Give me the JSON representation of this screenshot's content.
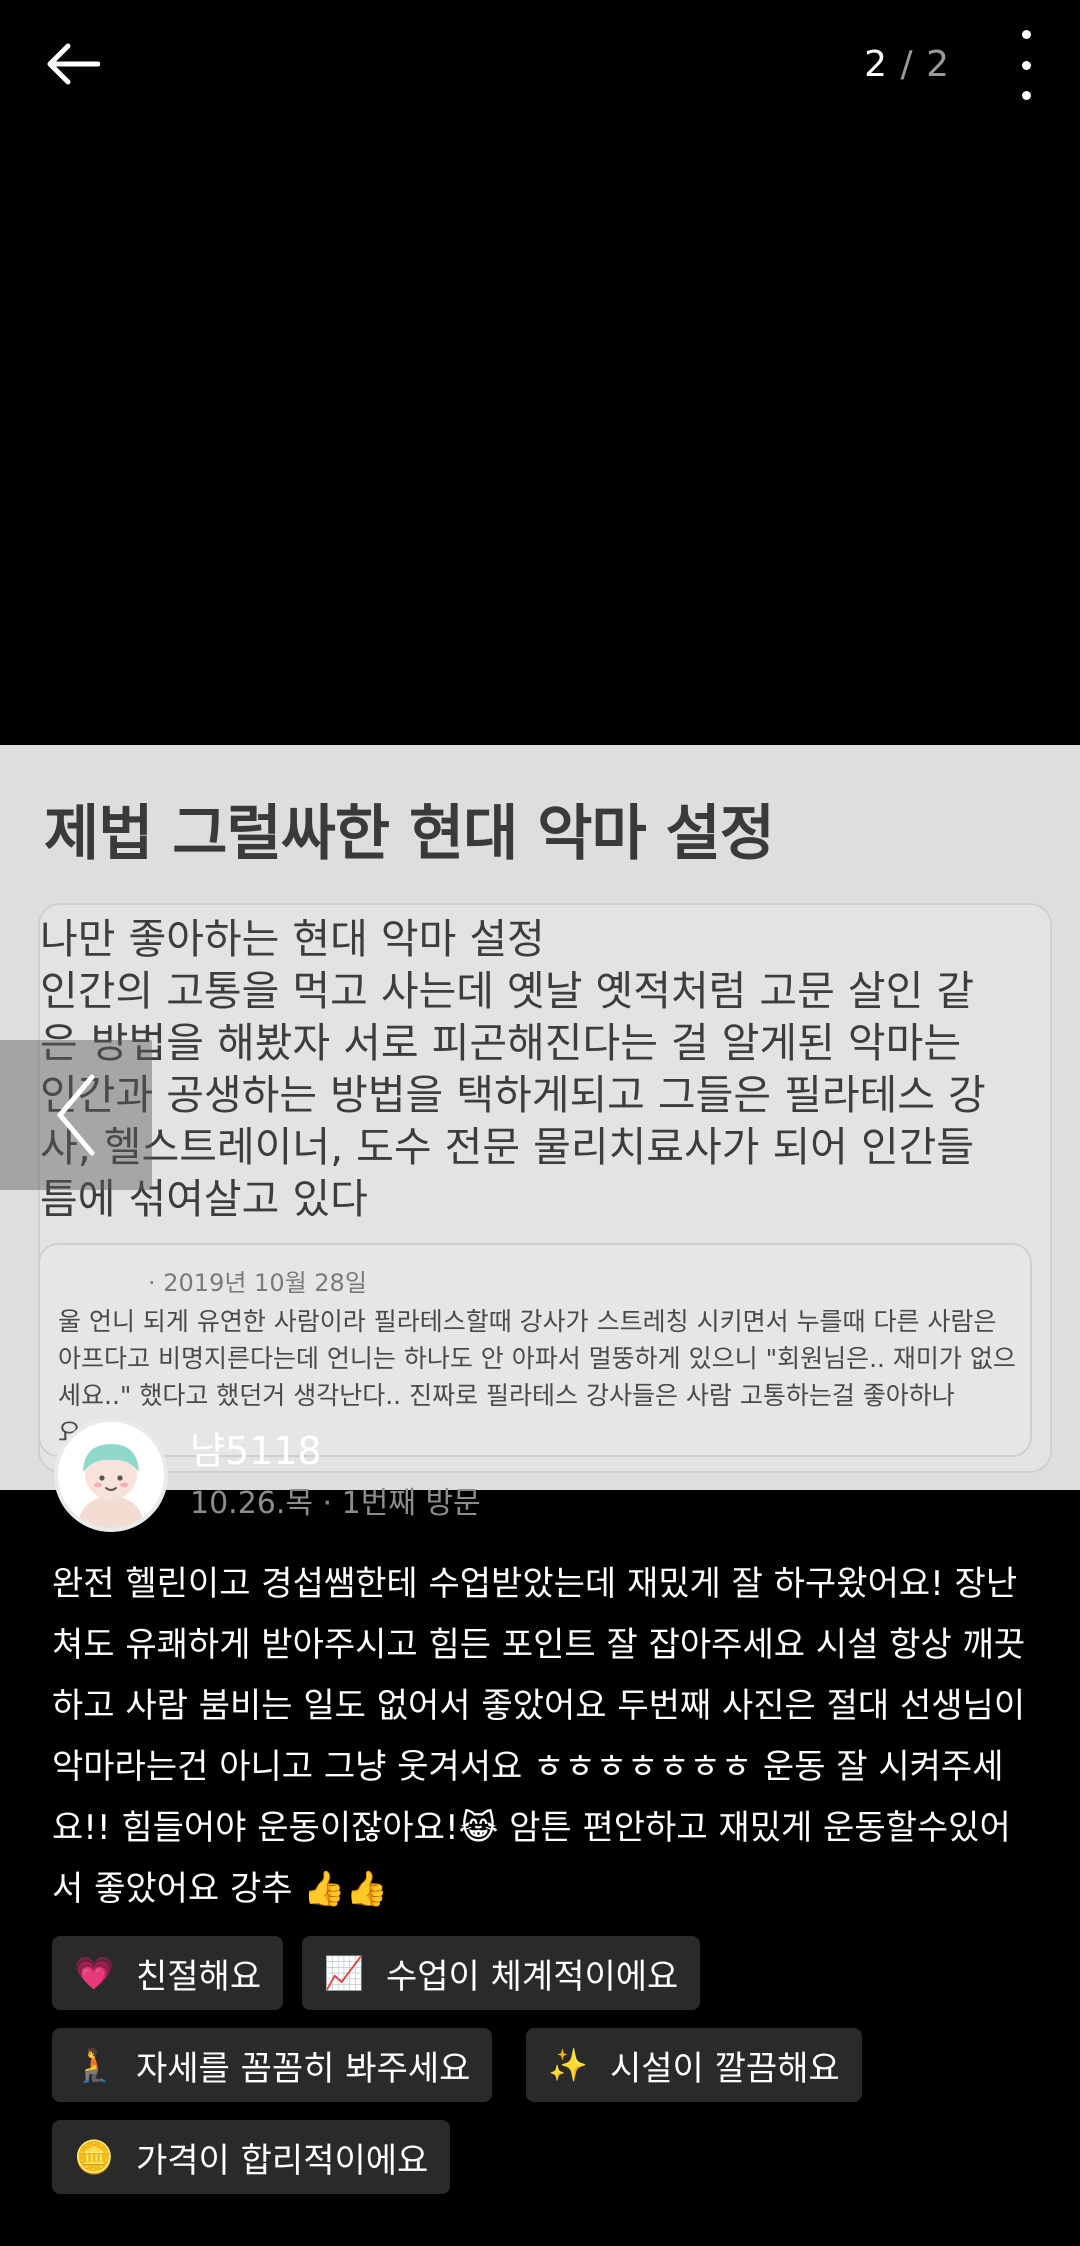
{
  "header": {
    "current_page": "2",
    "separator": "/",
    "total_pages": "2"
  },
  "photo": {
    "title": "제법 그럴싸한 현대 악마 설정",
    "body_lines": [
      "나만 좋아하는 현대 악마 설정",
      "인간의 고통을 먹고 사는데 옛날 옛적처럼 고문 살인 같",
      "은 방법을 해봤자 서로 피곤해진다는 걸 알게된 악마는",
      "인간과 공생하는 방법을 택하게되고 그들은 필라테스 강",
      "사, 헬스트레이너, 도수 전문 물리치료사가 되어 인간들",
      "틈에 섞여살고 있다"
    ],
    "comment_date": "· 2019년 10월 28일",
    "comment_text": "울 언니 되게 유연한 사람이라 필라테스할때 강사가 스트레칭 시키면서 누를때 다른 사람은 아프다고 비명지른다는데 언니는 하나도 안 아파서 멀뚱하게 있으니 \"회원님은.. 재미가 없으세요..\" 했다고 했던거 생각난다.. 진짜로 필라테스 강사들은 사람 고통하는걸 좋아하나요....?"
  },
  "author": {
    "name": "냠5118",
    "meta": "10.26.목 · 1번째 방문"
  },
  "review": {
    "text": "완전 헬린이고 경섭쌤한테 수업받았는데 재밌게 잘 하구왔어요! 장난쳐도 유쾌하게 받아주시고 힘든 포인트 잘 잡아주세요 시설 항상 깨끗하고 사람 붐비는 일도 없어서 좋았어요 두번째 사진은 절대 선생님이 악마라는건 아니고 그냥 웃겨서요 ㅎㅎㅎㅎㅎㅎㅎ 운동 잘 시켜주세요!! 힘들어야 운동이잖아요!😹 암튼 편안하고 재밌게 운동할수있어서 좋았어요 강추 👍👍"
  },
  "tags": [
    {
      "label": "친절해요",
      "icon": "heart-icon",
      "glyph": "💗"
    },
    {
      "label": "수업이 체계적이에요",
      "icon": "chart-up-icon",
      "glyph": "📈"
    },
    {
      "label": "자세를 꼼꼼히 봐주세요",
      "icon": "exercise-icon",
      "glyph": "🧎"
    },
    {
      "label": "시설이 깔끔해요",
      "icon": "sparkles-icon",
      "glyph": "✨"
    },
    {
      "label": "가격이 합리적이에요",
      "icon": "coins-icon",
      "glyph": "🪙"
    }
  ]
}
